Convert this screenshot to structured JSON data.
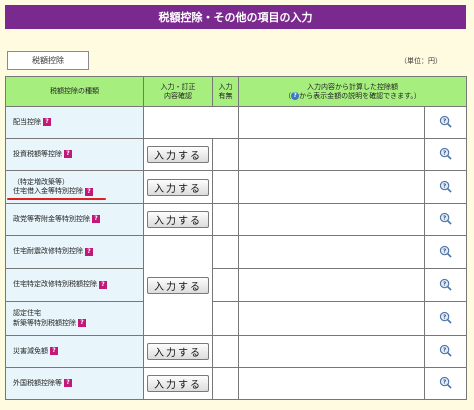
{
  "page": {
    "title": "税額控除・その他の項目の入力",
    "tab_label": "税額控除",
    "unit": "（単位：円）"
  },
  "table": {
    "headers": {
      "type": "税額控除の種類",
      "confirm": "入力・訂正\n内容確認",
      "presence": "入力\n有無",
      "amount_line1": "入力内容から計算した控除額",
      "amount_line2_pre": "（",
      "amount_line2_post": "から表示金額の説明を確認できます。）"
    },
    "input_button_label": "入力する",
    "help_symbol": "?",
    "rows": [
      {
        "label": "配当控除"
      },
      {
        "label": "投資税額等控除"
      },
      {
        "label": "（特定増改築等）\n住宅借入金等特別控除"
      },
      {
        "label": "政党等寄附金等特別控除"
      },
      {
        "label": "住宅耐震改修特別控除"
      },
      {
        "label": "住宅特定改修特別税額控除"
      },
      {
        "label": "認定住宅\n新築等特別税額控除"
      },
      {
        "label": "災害減免額"
      },
      {
        "label": "外国税額控除等"
      }
    ]
  },
  "colors": {
    "title_bg": "#7a2a8e",
    "header_bg": "#a6ef7f",
    "name_cell_bg": "#e8f5fb",
    "help_marker": "#c2187a",
    "highlight_underline": "#e02020"
  },
  "icons": {
    "help_marker": "question-mark-icon",
    "help_link": "magnifier-question-icon",
    "header_info": "info-circle-icon"
  }
}
